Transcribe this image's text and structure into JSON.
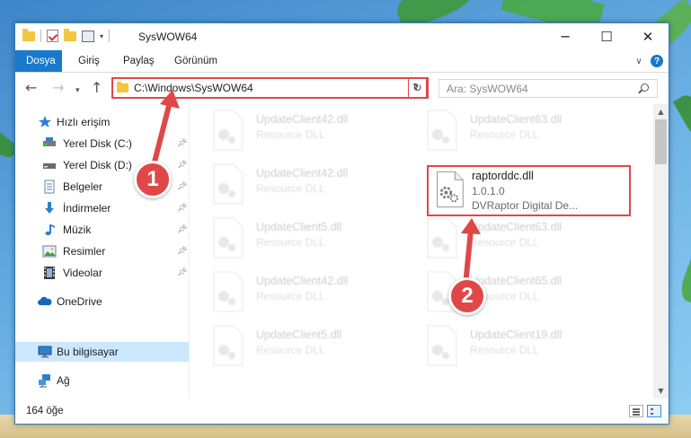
{
  "window": {
    "title": "SysWOW64",
    "controls": [
      "─",
      "☐",
      "✕"
    ]
  },
  "ribbon": {
    "tabs": [
      "Dosya",
      "Giriş",
      "Paylaş",
      "Görünüm"
    ],
    "active_tab": "Dosya",
    "accent_color": "#1979ca"
  },
  "addressbar": {
    "path": "C:\\Windows\\SysWOW64",
    "search_placeholder": "Ara: SysWOW64"
  },
  "navpane": {
    "quick_access": "Hızlı erişim",
    "items": [
      {
        "label": "Yerel Disk (C:)",
        "icon": "drive-icon",
        "pinned": true
      },
      {
        "label": "Yerel Disk (D:)",
        "icon": "drive-icon",
        "pinned": true
      },
      {
        "label": "Belgeler",
        "icon": "documents-icon",
        "pinned": true
      },
      {
        "label": "İndirmeler",
        "icon": "downloads-icon",
        "pinned": true
      },
      {
        "label": "Müzik",
        "icon": "music-icon",
        "pinned": true
      },
      {
        "label": "Resimler",
        "icon": "pictures-icon",
        "pinned": true
      },
      {
        "label": "Videolar",
        "icon": "videos-icon",
        "pinned": true
      }
    ],
    "onedrive": "OneDrive",
    "this_pc": "Bu bilgisayar",
    "network": "Ağ"
  },
  "files": {
    "left_column": [
      {
        "name": "UpdateClient42.dll",
        "type": "Resource DLL"
      },
      {
        "name": "UpdateClient42.dll",
        "type": "Resource DLL"
      },
      {
        "name": "UpdateClient5.dll",
        "type": "Resource DLL"
      },
      {
        "name": "UpdateClient42.dll",
        "type": "Resource DLL"
      },
      {
        "name": "UpdateClient5.dll",
        "type": "Resource DLL"
      }
    ],
    "right_column": [
      {
        "name": "UpdateClient63.dll",
        "type": "Resource DLL"
      },
      {
        "name": "UpdateClient63.dll",
        "type": "Resource DLL"
      },
      {
        "name": "UpdateClient65.dll",
        "type": "Resource DLL"
      },
      {
        "name": "UpdateClient19.dll",
        "type": "Resource DLL"
      }
    ],
    "highlighted": {
      "name": "raptorddc.dll",
      "version": "1.0.1.0",
      "description": "DVRaptor Digital De..."
    }
  },
  "status": {
    "count": "164 öğe"
  },
  "annotations": {
    "step1": "1",
    "step2": "2",
    "color": "#e04848"
  }
}
